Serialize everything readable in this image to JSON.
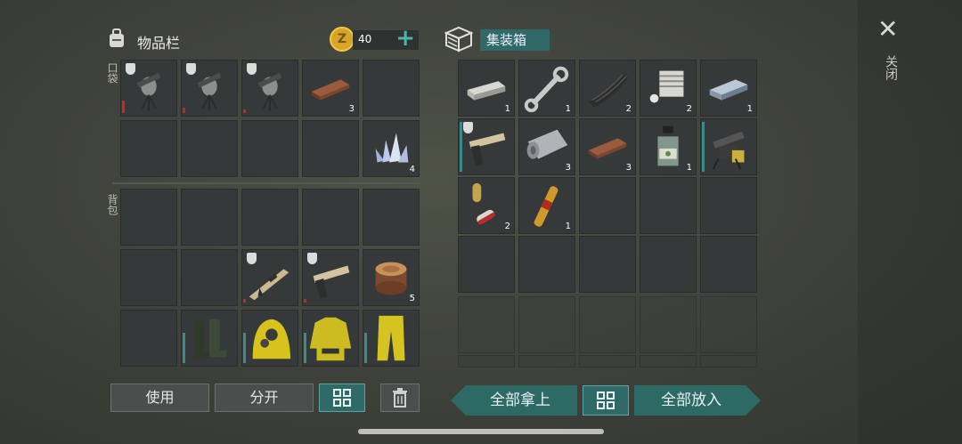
{
  "inventory": {
    "title": "物品栏",
    "coins": "40",
    "add_symbol": "+",
    "coin_letter": "Z",
    "pocket_label": "口袋",
    "backpack_label": "背包"
  },
  "container": {
    "title": "集装箱"
  },
  "close": {
    "symbol": "✕",
    "label": "关闭"
  },
  "buttons": {
    "use": "使用",
    "split": "分开",
    "take_all": "全部拿上",
    "put_all": "全部放入"
  },
  "pocket_counts": {
    "plank": "3",
    "crystal": "4"
  },
  "backpack_counts": {
    "log": "5"
  },
  "container_counts": {
    "ingot": "1",
    "wrench": "1",
    "rubber": "2",
    "engine": "2",
    "iron": "1",
    "cloth": "3",
    "plank": "3",
    "jar": "1",
    "pills": "2",
    "ampoule": "1"
  },
  "colors": {
    "accent": "#2f6a68",
    "durability_red": "#c02a25",
    "durability_teal": "#3d8a86"
  }
}
